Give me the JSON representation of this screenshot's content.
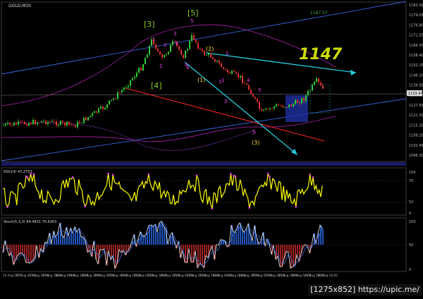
{
  "window": {
    "symbol_label": "GOLD,M30"
  },
  "watermark": "1147",
  "price_axis": {
    "ticks": [
      "1183.30",
      "1179.05",
      "1176.80",
      "1171.55",
      "1164.55",
      "1158.40",
      "1152.25",
      "1146.10",
      "1139.95",
      "1133.80",
      "1127.65",
      "1121.50",
      "1115.35",
      "1109.20",
      "1102.45",
      "1096.30"
    ],
    "current_price": "1133.47",
    "resistance_label": "1187.57"
  },
  "waves": {
    "major_3": "[3]",
    "major_4": "[4]",
    "major_5": "[5]",
    "minor_3": "3",
    "minor_5": "5",
    "sub_1": "(1)",
    "sub_2": "(2)",
    "sub_3": "(3)",
    "tiny": [
      "1",
      "2",
      "3",
      "4",
      "5",
      "1",
      "2",
      "3",
      "4",
      "5",
      "2",
      "3",
      "4",
      "1"
    ]
  },
  "rsi_panel": {
    "label": "RSI(14) 47.2753",
    "levels": [
      "100",
      "70",
      "50",
      "30",
      "0"
    ],
    "level_mark": "52"
  },
  "stoch_panel": {
    "label": "Stoch(5,3,3) 64.4831 70.4263",
    "levels": [
      "100",
      "80",
      "50",
      "20",
      "0"
    ]
  },
  "time_axis": [
    "14 Aug 2015",
    "17 Aug 02:00",
    "17 Aug 10:00",
    "17 Aug 18:00",
    "18 Aug 02:00",
    "18 Aug 10:00",
    "18 Aug 18:00",
    "19 Aug 02:00",
    "19 Aug 10:00",
    "19 Aug 18:00",
    "20 Aug 02:00",
    "20 Aug 10:00",
    "20 Aug 18:00",
    "21 Aug 02:00",
    "21 Aug 10:00",
    "21 Aug 18:00",
    "24 Aug 02:00",
    "24 Aug 10:00",
    "24 Aug 18:00",
    "25 Aug 02:00",
    "25 Aug 10:00",
    "25 Aug 18:00",
    "26 Aug 02:00",
    "26 Aug 10:00",
    "26 Aug 18:00"
  ],
  "footer": "[1275x852] https://upic.me/",
  "colors": {
    "bg": "#000000",
    "candle_up": "#33cc33",
    "candle_down": "#e03030",
    "wave_green": "#88cc22",
    "wave_magenta": "#ee44ee",
    "channel_blue": "#3366dd",
    "trend_cyan": "#22ccdd",
    "trend_red": "#ee2222",
    "box_blue": "#2233aa",
    "rsi_yellow": "#ffff00",
    "stoch_white": "#dddddd",
    "hist_blue": "#2255bb",
    "hist_red": "#992222"
  }
}
